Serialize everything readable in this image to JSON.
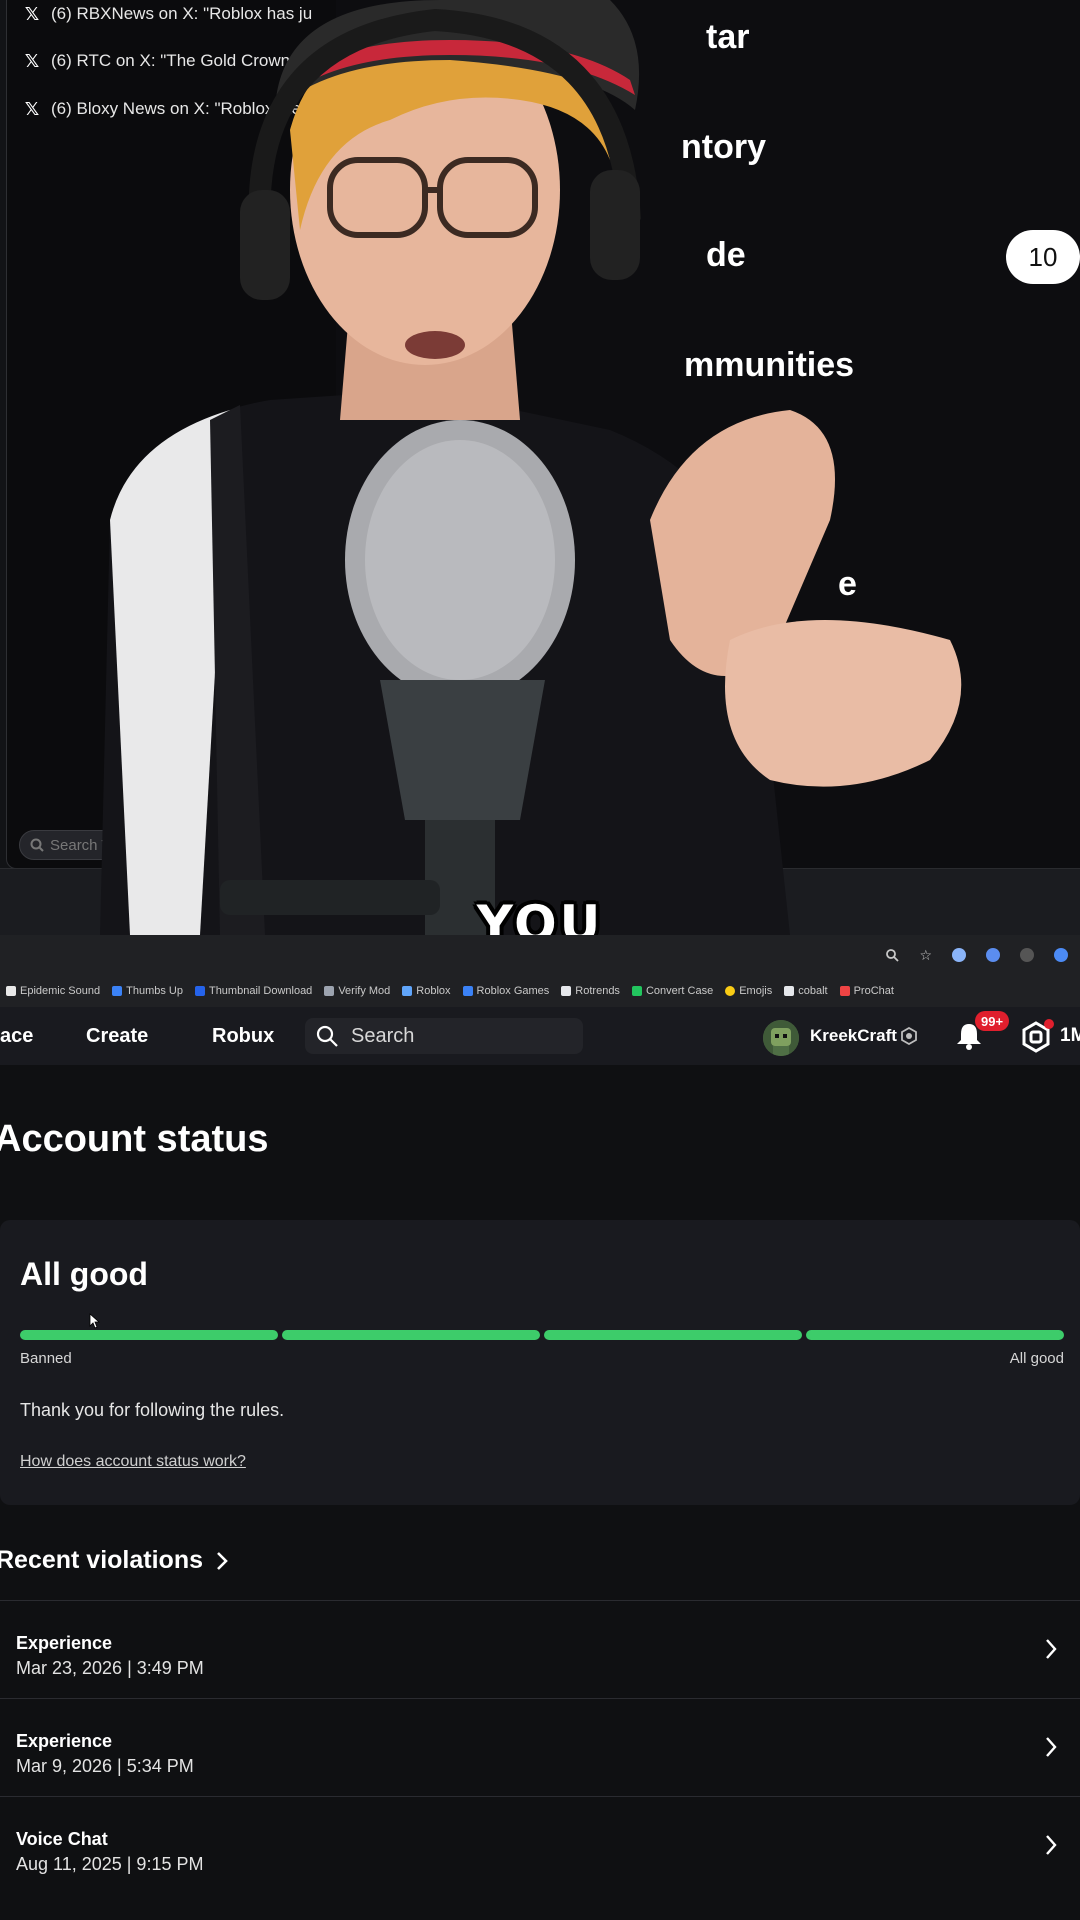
{
  "overlay": {
    "tabs": [
      {
        "label": "(6) RBXNews on X: \"Roblox has ju"
      },
      {
        "label": "(6) RTC on X: \"The Gold Crown"
      },
      {
        "label": "(6) Bloxy News on X: \"Roblox  i  te"
      }
    ],
    "tab_search_placeholder": "Search Tabs",
    "menu_items": [
      "tar",
      "ntory",
      "de",
      "mmunities",
      "e"
    ],
    "menu_badge": "10",
    "caption": "YOU"
  },
  "bookmarks": [
    {
      "label": "Epidemic Sound",
      "color": "#e8e8e8"
    },
    {
      "label": "Thumbs Up",
      "color": "#3b82f6"
    },
    {
      "label": "Thumbnail Download",
      "color": "#2563eb"
    },
    {
      "label": "Verify Mod",
      "color": "#9ca3af"
    },
    {
      "label": "Roblox",
      "color": "#60a5fa"
    },
    {
      "label": "Roblox Games",
      "color": "#3b82f6"
    },
    {
      "label": "Rotrends",
      "color": "#e5e7eb"
    },
    {
      "label": "Convert Case",
      "color": "#22c55e"
    },
    {
      "label": "Emojis",
      "color": "#facc15"
    },
    {
      "label": "cobalt",
      "color": "#e5e7eb"
    },
    {
      "label": "ProChat",
      "color": "#ef4444"
    }
  ],
  "nav": {
    "marketplace": "ace",
    "create": "Create",
    "robux": "Robux",
    "search_placeholder": "Search",
    "username": "KreekCraft",
    "notifications": "99+",
    "robux_amount": "1M"
  },
  "page": {
    "title": "Account status",
    "status": {
      "heading": "All good",
      "level_segments_filled": 4,
      "level_segments_total": 4,
      "label_low": "Banned",
      "label_high": "All good",
      "message": "Thank you for following the rules.",
      "help_link": "How does account status work?"
    },
    "violations_header": "Recent violations",
    "violations": [
      {
        "type": "Experience",
        "date": "Mar 23, 2026 | 3:49 PM"
      },
      {
        "type": "Experience",
        "date": "Mar 9, 2026 | 5:34 PM"
      },
      {
        "type": "Voice Chat",
        "date": "Aug 11, 2025 | 9:15 PM"
      }
    ]
  },
  "colors": {
    "accent_green": "#3dcc6a",
    "badge_red": "#e01f2d",
    "background": "#0f1012",
    "card": "#191a1f"
  }
}
